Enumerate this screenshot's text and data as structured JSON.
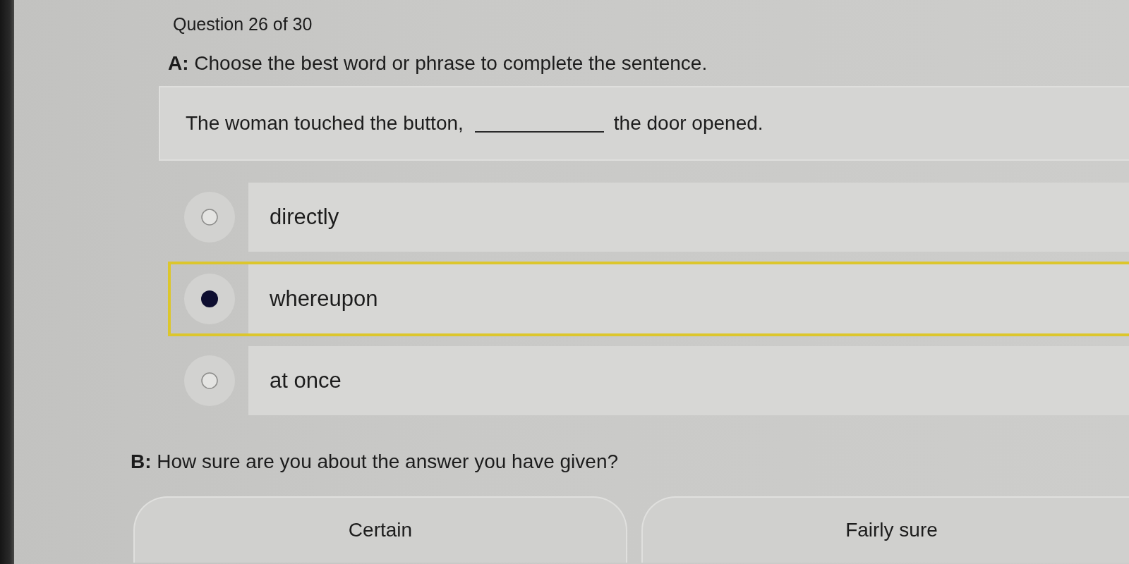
{
  "header": {
    "progress": "Question 26 of 30"
  },
  "part_a": {
    "instruction": "**A:** Choose the best word or phrase to complete the sentence.",
    "sentence": {
      "before": "The woman touched the button,",
      "after": "the door opened."
    },
    "options": [
      {
        "text": "directly",
        "selected": false
      },
      {
        "text": "whereupon",
        "selected": true
      },
      {
        "text": "at once",
        "selected": false
      }
    ]
  },
  "part_b": {
    "question": "**B:** How sure are you about the answer you have given?",
    "options": [
      {
        "text": "Certain",
        "selected": false
      },
      {
        "text": "Fairly sure",
        "selected": false
      }
    ]
  }
}
